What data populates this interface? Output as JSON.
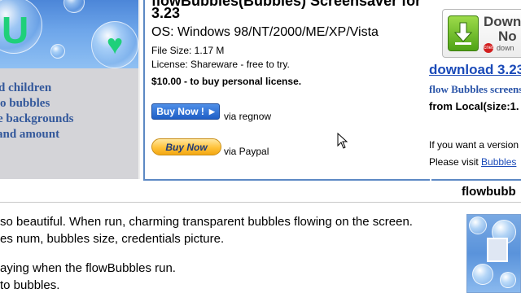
{
  "promo": {
    "lines": [
      "d children",
      "o bubbles",
      "e backgrounds",
      "and amount"
    ],
    "art_letters": [
      "U",
      "♥"
    ]
  },
  "info": {
    "title": "flowBubbles(Bubbles) Screensaver for",
    "version": "3.23",
    "os": "OS: Windows 98/NT/2000/ME/XP/Vista",
    "file_size": "File Size: 1.17 M",
    "license": "License: Shareware - free to try.",
    "price": "$10.00 - to buy personal license.",
    "buy_regnow_label": "Buy Now !",
    "via_regnow": "via regnow",
    "buy_paypal_label": "Buy Now",
    "via_paypal": "via Paypal"
  },
  "download": {
    "badge_title_1": "Down",
    "badge_title_2": "No",
    "cnet_logo": "cnet",
    "cnet_small": "down",
    "link": "download 3.23",
    "subtitle": "flow Bubbles screens",
    "local": "from Local(size:1.",
    "version_prompt": "If you want a version",
    "visit_prefix": "Please visit ",
    "visit_link": "Bubbles"
  },
  "lower": {
    "title": "flowbubb",
    "lines": [
      "so beautiful. When run, charming transparent bubbles flowing on the screen.",
      "es num, bubbles size, credentials picture.",
      "aying when the flowBubbles run.",
      "to bubbles."
    ]
  },
  "colors": {
    "panel_border": "#5d89c4",
    "promo_text": "#33589b",
    "link": "#1a4ab8"
  }
}
